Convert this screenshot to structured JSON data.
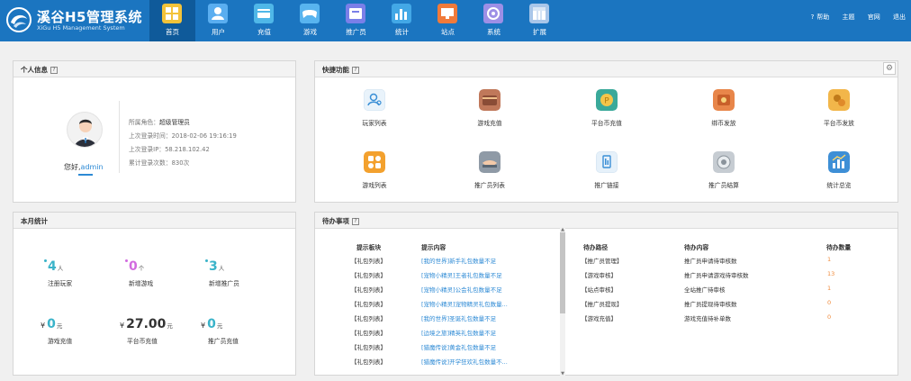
{
  "header": {
    "logo_title": "溪谷H5管理系统",
    "logo_subtitle": "XiGu H5 Management System",
    "nav": [
      {
        "label": "首页",
        "icon": "home-icon",
        "color": "#f3c33a",
        "active": true
      },
      {
        "label": "用户",
        "icon": "user-icon",
        "color": "#5aaef0"
      },
      {
        "label": "充值",
        "icon": "recharge-icon",
        "color": "#4fb7e8"
      },
      {
        "label": "游戏",
        "icon": "gamepad-icon",
        "color": "#58b4ef"
      },
      {
        "label": "推广员",
        "icon": "promoter-icon",
        "color": "#7a7fe8"
      },
      {
        "label": "统计",
        "icon": "chart-icon",
        "color": "#43a8e6"
      },
      {
        "label": "站点",
        "icon": "site-icon",
        "color": "#f07a3a"
      },
      {
        "label": "系统",
        "icon": "system-icon",
        "color": "#9d8fe6"
      },
      {
        "label": "扩展",
        "icon": "extend-icon",
        "color": "#a9c6e9"
      }
    ],
    "links": [
      "帮助",
      "主题",
      "官网",
      "退出"
    ]
  },
  "personal": {
    "title": "个人信息",
    "help": "?",
    "greeting": "您好,",
    "username": "admin",
    "role_label": "所属角色：",
    "role_value": "超级管理员",
    "last_login_label": "上次登录时间：",
    "last_login_value": "2018-02-06 19:16:19",
    "last_ip_label": "上次登录IP：",
    "last_ip_value": "58.218.102.42",
    "count_label": "累计登录次数：",
    "count_value": "830次"
  },
  "quick": {
    "title": "快捷功能",
    "help": "?",
    "gear": "⚙",
    "items": [
      {
        "label": "玩家列表",
        "icon": "player-list-icon",
        "color": "#e9f3fb"
      },
      {
        "label": "游戏充值",
        "icon": "game-recharge-icon",
        "color": "#c0785a"
      },
      {
        "label": "平台币充值",
        "icon": "platform-coin-recharge-icon",
        "color": "#3aa99a"
      },
      {
        "label": "绑币发放",
        "icon": "bind-coin-icon",
        "color": "#e8864a"
      },
      {
        "label": "平台币发放",
        "icon": "platform-coin-issue-icon",
        "color": "#f2b64a"
      },
      {
        "label": "游戏列表",
        "icon": "game-list-icon",
        "color": "#f3a12e"
      },
      {
        "label": "推广员列表",
        "icon": "promoter-list-icon",
        "color": "#8f9aa6"
      },
      {
        "label": "推广链接",
        "icon": "promo-link-icon",
        "color": "#e6f1fa"
      },
      {
        "label": "推广员结算",
        "icon": "settlement-icon",
        "color": "#c6ccd2"
      },
      {
        "label": "统计总览",
        "icon": "stats-overview-icon",
        "color": "#3e8fd6"
      }
    ]
  },
  "monthly": {
    "title": "本月统计",
    "stats": [
      {
        "value": "4",
        "unit": "人",
        "label": "注册玩家",
        "color": "#3ab3c9"
      },
      {
        "value": "0",
        "unit": "个",
        "label": "新增游戏",
        "color": "#d26bdf"
      },
      {
        "value": "3",
        "unit": "人",
        "label": "新增推广员",
        "color": "#3ab3c9"
      },
      {
        "currency": "¥",
        "value": "0",
        "unit": "元",
        "label": "游戏充值",
        "color": "#3ab3c9"
      },
      {
        "currency": "¥",
        "value": "27.00",
        "unit": "元",
        "label": "平台币充值",
        "color": "#333333"
      },
      {
        "currency": "¥",
        "value": "0",
        "unit": "元",
        "label": "推广员充值",
        "color": "#3ab3c9"
      }
    ]
  },
  "todo": {
    "title": "待办事项",
    "help": "?",
    "left_headers": [
      "提示板块",
      "提示内容"
    ],
    "left_rows": [
      [
        "【礼包列表】",
        "[我的世界]新手礼包数量不足"
      ],
      [
        "【礼包列表】",
        "[宠物小精灵]王者礼包数量不足"
      ],
      [
        "【礼包列表】",
        "[宠物小精灵]公会礼包数量不足"
      ],
      [
        "【礼包列表】",
        "[宠物小精灵]宠物精灵礼包数量..."
      ],
      [
        "【礼包列表】",
        "[我的世界]圣诞礼包数量不足"
      ],
      [
        "【礼包列表】",
        "[边境之旅]精英礼包数量不足"
      ],
      [
        "【礼包列表】",
        "[猎魔传说]黄金礼包数量不足"
      ],
      [
        "【礼包列表】",
        "[猎魔传说]开学狂欢礼包数量不..."
      ]
    ],
    "right_headers": [
      "待办路径",
      "待办内容",
      "待办数量"
    ],
    "right_rows": [
      [
        "【推广员管理】",
        "推广员申请待审核数",
        "1"
      ],
      [
        "【游戏审核】",
        "推广员申请游戏待审核数",
        "13"
      ],
      [
        "【站点审核】",
        "全站推广待审核",
        "1"
      ],
      [
        "【推广员提现】",
        "推广员提现待审核数",
        "0"
      ],
      [
        "【游戏充值】",
        "游戏充值待补单数",
        "0"
      ]
    ]
  }
}
